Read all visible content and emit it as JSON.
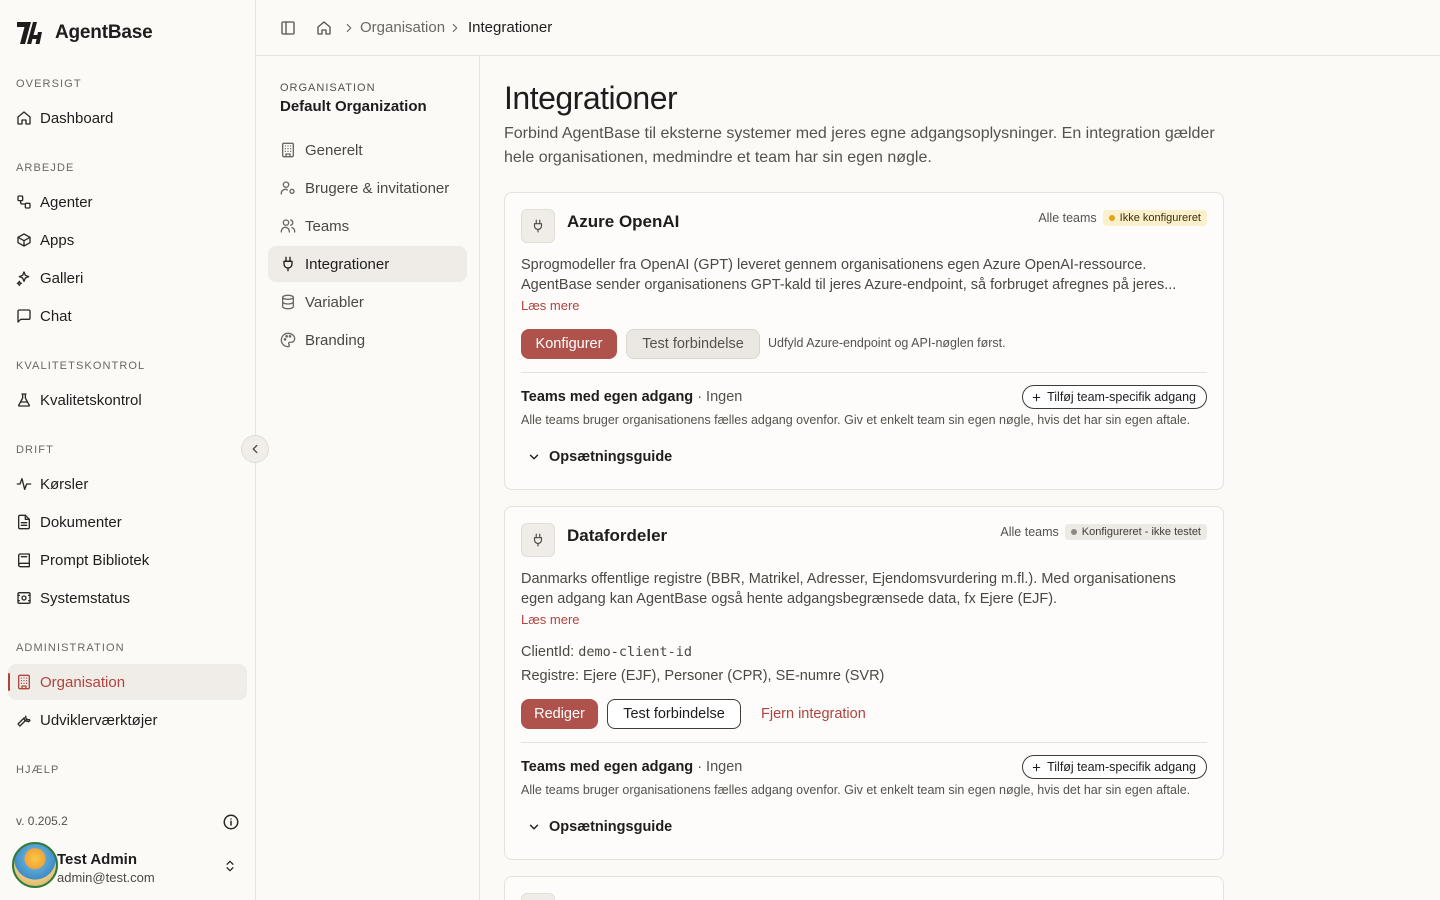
{
  "brand": {
    "name": "AgentBase"
  },
  "sidebar": {
    "sections": [
      {
        "label": "OVERSIGT"
      },
      {
        "label": "ARBEJDE"
      },
      {
        "label": "KVALITETSKONTROL"
      },
      {
        "label": "DRIFT"
      },
      {
        "label": "ADMINISTRATION"
      },
      {
        "label": "HJÆLP"
      }
    ],
    "items": [
      {
        "label": "Dashboard",
        "icon": "home-icon"
      },
      {
        "label": "Agenter",
        "icon": "workflow-icon"
      },
      {
        "label": "Apps",
        "icon": "box-icon"
      },
      {
        "label": "Galleri",
        "icon": "sparkles-icon"
      },
      {
        "label": "Chat",
        "icon": "message-square-icon"
      },
      {
        "label": "Kvalitetskontrol",
        "icon": "flask-icon"
      },
      {
        "label": "Kørsler",
        "icon": "activity-icon"
      },
      {
        "label": "Dokumenter",
        "icon": "file-text-icon"
      },
      {
        "label": "Prompt Bibliotek",
        "icon": "book-icon"
      },
      {
        "label": "Systemstatus",
        "icon": "server-status-icon"
      },
      {
        "label": "Organisation",
        "icon": "building-icon",
        "active": true
      },
      {
        "label": "Udviklerværktøjer",
        "icon": "wrench-icon"
      }
    ],
    "version": "v. 0.205.2",
    "user": {
      "name": "Test Admin",
      "email": "admin@test.com"
    }
  },
  "breadcrumb": {
    "items": [
      "Organisation",
      "Integrationer"
    ]
  },
  "subnav": {
    "section_label": "ORGANISATION",
    "org_name": "Default Organization",
    "items": [
      {
        "label": "Generelt",
        "icon": "building-icon"
      },
      {
        "label": "Brugere & invitationer",
        "icon": "user-cog-icon"
      },
      {
        "label": "Teams",
        "icon": "users-icon"
      },
      {
        "label": "Integrationer",
        "icon": "plug-icon",
        "active": true
      },
      {
        "label": "Variabler",
        "icon": "database-icon"
      },
      {
        "label": "Branding",
        "icon": "palette-icon"
      }
    ]
  },
  "page": {
    "title": "Integrationer",
    "description": "Forbind AgentBase til eksterne systemer med jeres egne adgangsoplysninger. En integration gælder hele organisationen, medmindre et team har sin egen nøgle."
  },
  "integrations": [
    {
      "name": "Azure OpenAI",
      "scope": "Alle teams",
      "status": "Ikke konfigureret",
      "status_color": "#e1a21c",
      "description": "Sprogmodeller fra OpenAI (GPT) leveret gennem organisationens egen Azure OpenAI-ressource. AgentBase sender organisationens GPT-kald til jeres Azure-endpoint, så forbruget afregnes på jeres...",
      "read_more": "Læs mere",
      "primary_button": "Konfigurer",
      "test_button": "Test forbindelse",
      "hint": "Udfyld Azure-endpoint og API-nøglen først.",
      "teams_title": "Teams med egen adgang",
      "teams_count": "· Ingen",
      "add_team": "Tilføj team-specifik adgang",
      "teams_desc": "Alle teams bruger organisationens fælles adgang ovenfor. Giv et enkelt team sin egen nøgle, hvis det har sin egen aftale.",
      "guide": "Opsætningsguide"
    },
    {
      "name": "Datafordeler",
      "scope": "Alle teams",
      "status": "Konfigureret - ikke testet",
      "status_color": "#8d8983",
      "description": "Danmarks offentlige registre (BBR, Matrikel, Adresser, Ejendomsvurdering m.fl.). Med organisationens egen adgang kan AgentBase også hente adgangsbegrænsede data, fx Ejere (EJF).",
      "read_more": "Læs mere",
      "client_id_label": "ClientId:",
      "client_id_value": "demo-client-id",
      "registers": "Registre: Ejere (EJF), Personer (CPR), SE-numre (SVR)",
      "primary_button": "Rediger",
      "test_button": "Test forbindelse",
      "remove_button": "Fjern integration",
      "teams_title": "Teams med egen adgang",
      "teams_count": "· Ingen",
      "add_team": "Tilføj team-specifik adgang",
      "teams_desc": "Alle teams bruger organisationens fælles adgang ovenfor. Giv et enkelt team sin egen nøgle, hvis det har sin egen aftale.",
      "guide": "Opsætningsguide"
    }
  ],
  "colors": {
    "accent": "#b0433e",
    "background": "#fbfaf7",
    "border": "#e7e4de"
  }
}
